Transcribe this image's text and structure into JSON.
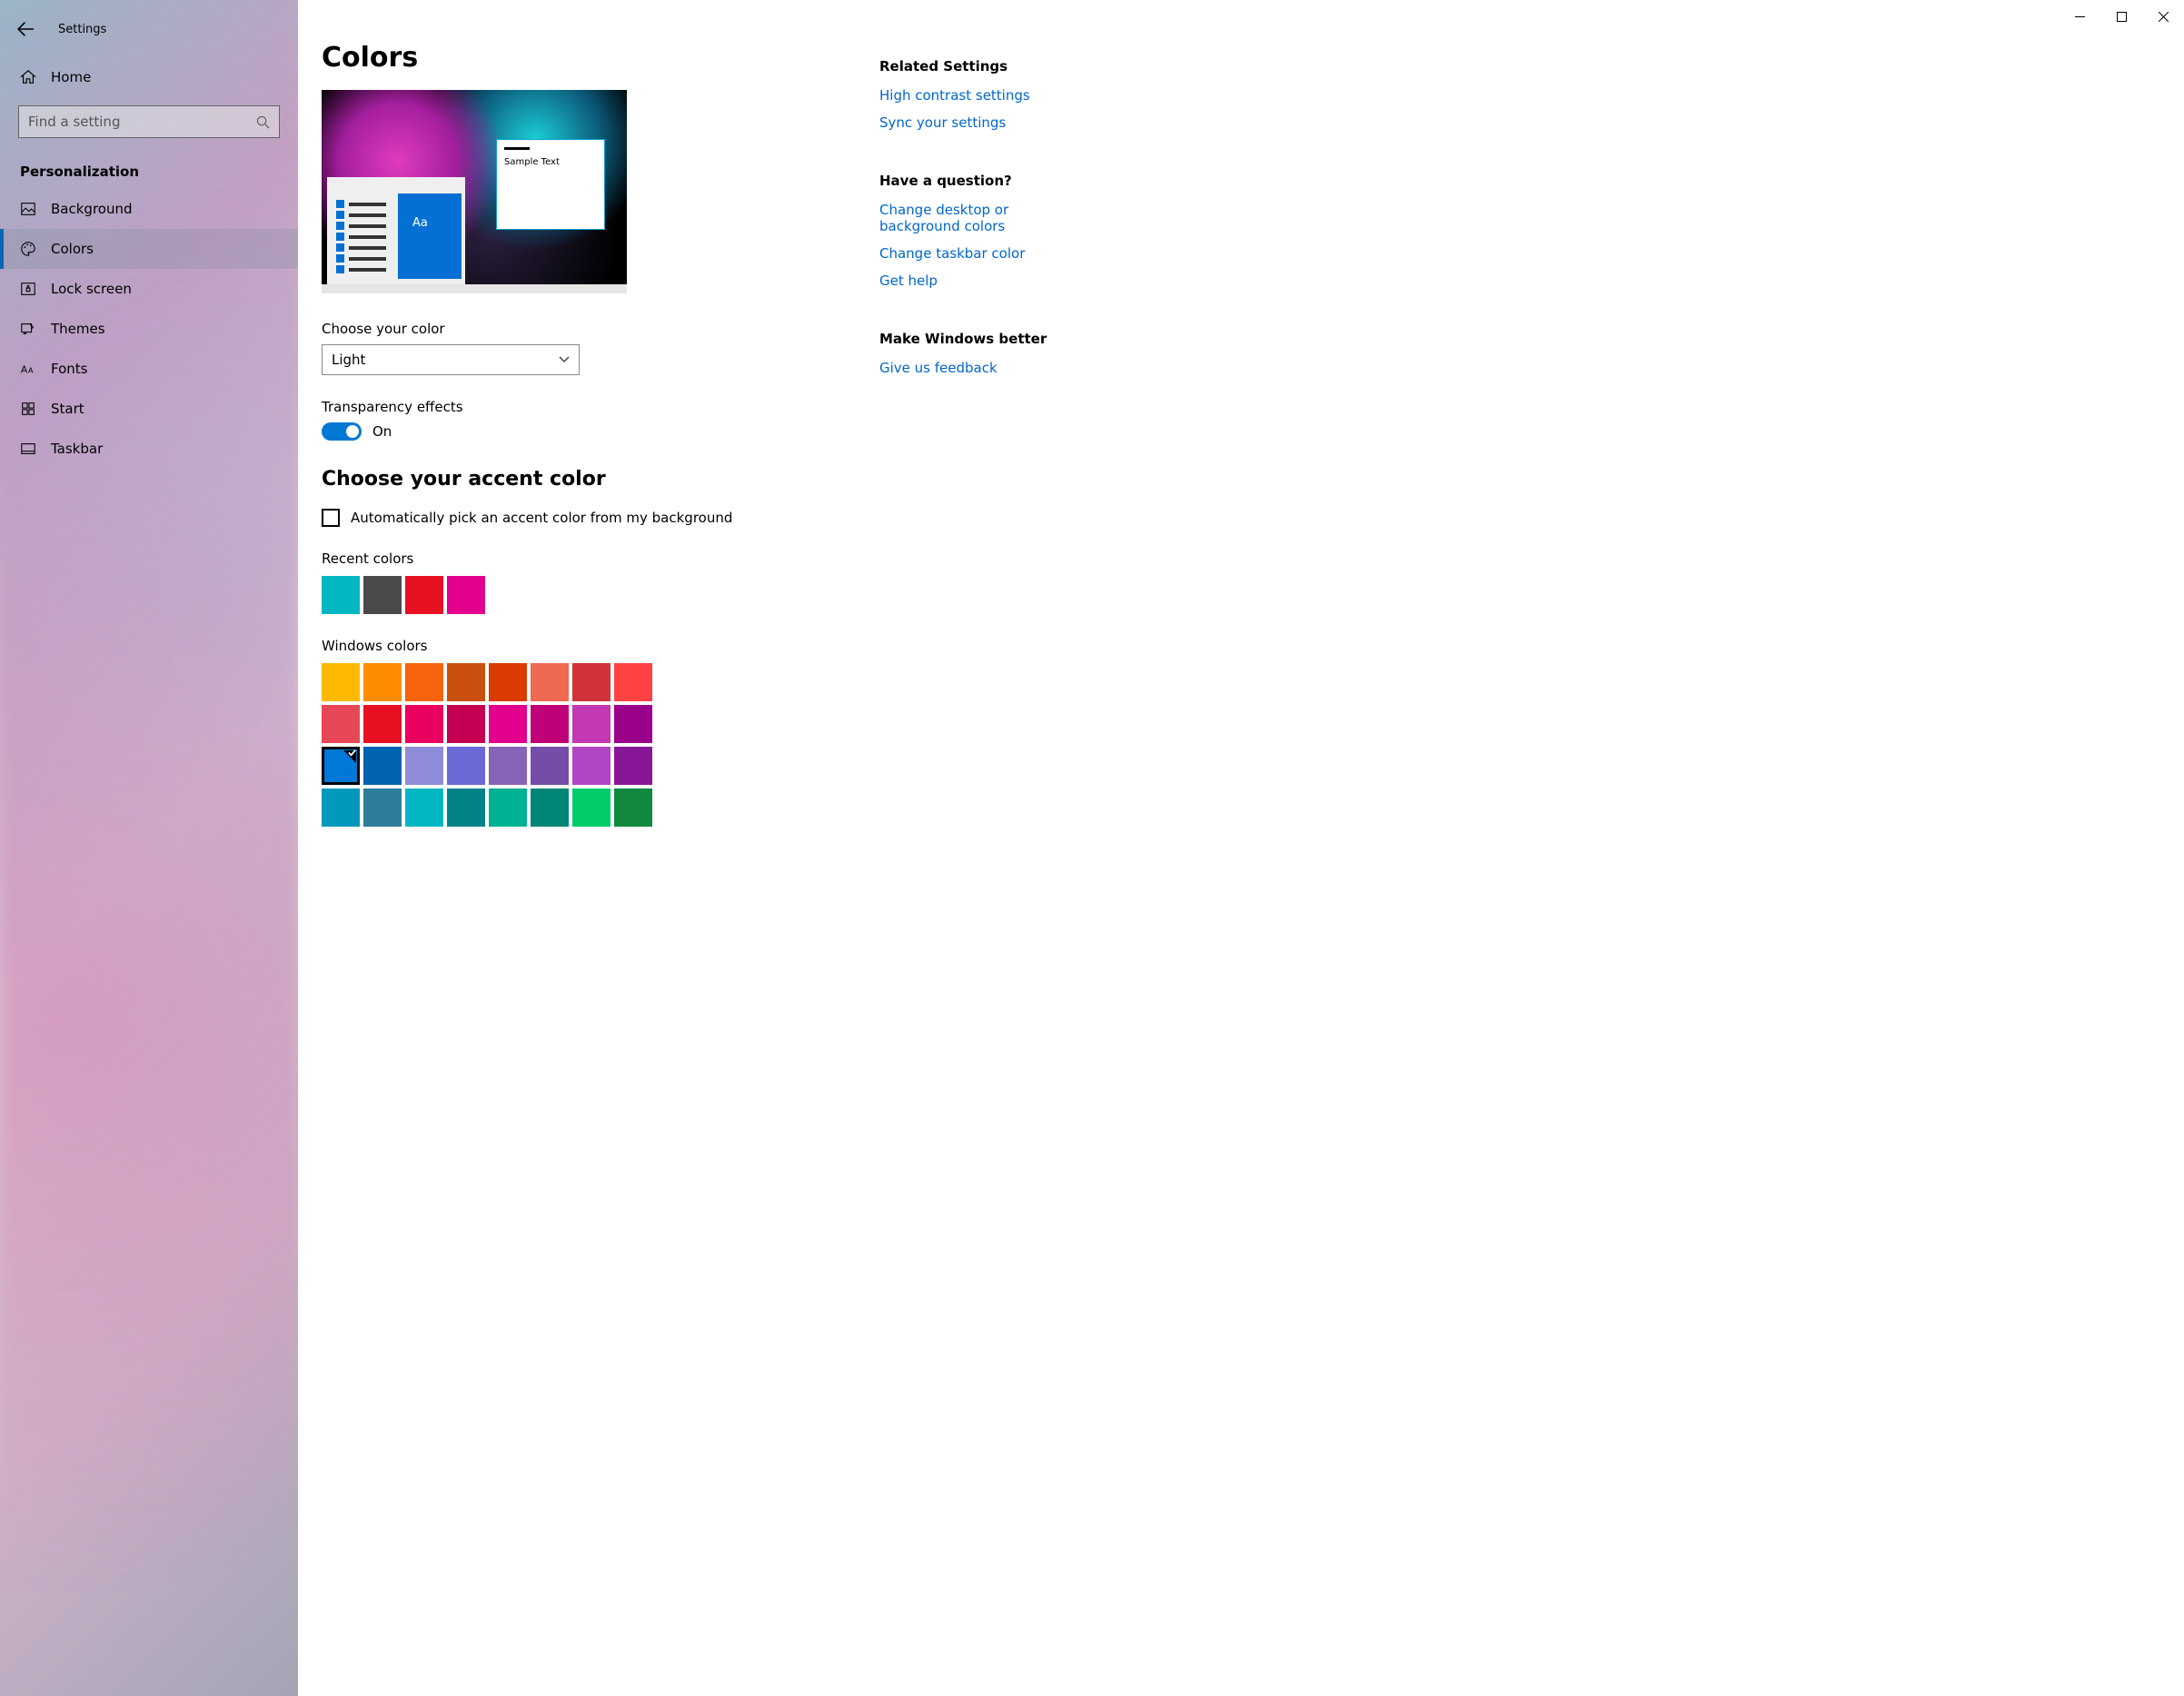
{
  "window": {
    "title": "Settings"
  },
  "sidebar": {
    "home": "Home",
    "search_placeholder": "Find a setting",
    "section": "Personalization",
    "items": [
      {
        "id": "background",
        "label": "Background"
      },
      {
        "id": "colors",
        "label": "Colors",
        "selected": true
      },
      {
        "id": "lockscreen",
        "label": "Lock screen"
      },
      {
        "id": "themes",
        "label": "Themes"
      },
      {
        "id": "fonts",
        "label": "Fonts"
      },
      {
        "id": "start",
        "label": "Start"
      },
      {
        "id": "taskbar",
        "label": "Taskbar"
      }
    ]
  },
  "page": {
    "title": "Colors",
    "preview": {
      "sample_text": "Sample Text",
      "aa": "Aa"
    },
    "choose_color": {
      "label": "Choose your color",
      "value": "Light"
    },
    "transparency": {
      "label": "Transparency effects",
      "state_label": "On",
      "on": true
    },
    "accent": {
      "heading": "Choose your accent color",
      "auto_label": "Automatically pick an accent color from my background",
      "auto_checked": false,
      "recent_label": "Recent colors",
      "recent": [
        "#00b7c3",
        "#4a4a4a",
        "#e81123",
        "#e3008c"
      ],
      "windows_label": "Windows colors",
      "windows": [
        "#ffb900",
        "#ff8c00",
        "#f7630c",
        "#ca5010",
        "#da3b01",
        "#ef6950",
        "#d13438",
        "#ff4343",
        "#e74856",
        "#e81123",
        "#ea005e",
        "#c30052",
        "#e3008c",
        "#bf0077",
        "#c239b3",
        "#9a0089",
        "#0078d7",
        "#0063b1",
        "#8e8cd8",
        "#6b69d6",
        "#8764b8",
        "#744da9",
        "#b146c2",
        "#881798",
        "#0099bc",
        "#2d7d9a",
        "#00b7c3",
        "#038387",
        "#00b294",
        "#018574",
        "#00cc6a",
        "#10893e"
      ],
      "selected_index": 16
    }
  },
  "right": {
    "related_head": "Related Settings",
    "related": [
      "High contrast settings",
      "Sync your settings"
    ],
    "question_head": "Have a question?",
    "question": [
      "Change desktop or background colors",
      "Change taskbar color",
      "Get help"
    ],
    "feedback_head": "Make Windows better",
    "feedback": [
      "Give us feedback"
    ]
  }
}
